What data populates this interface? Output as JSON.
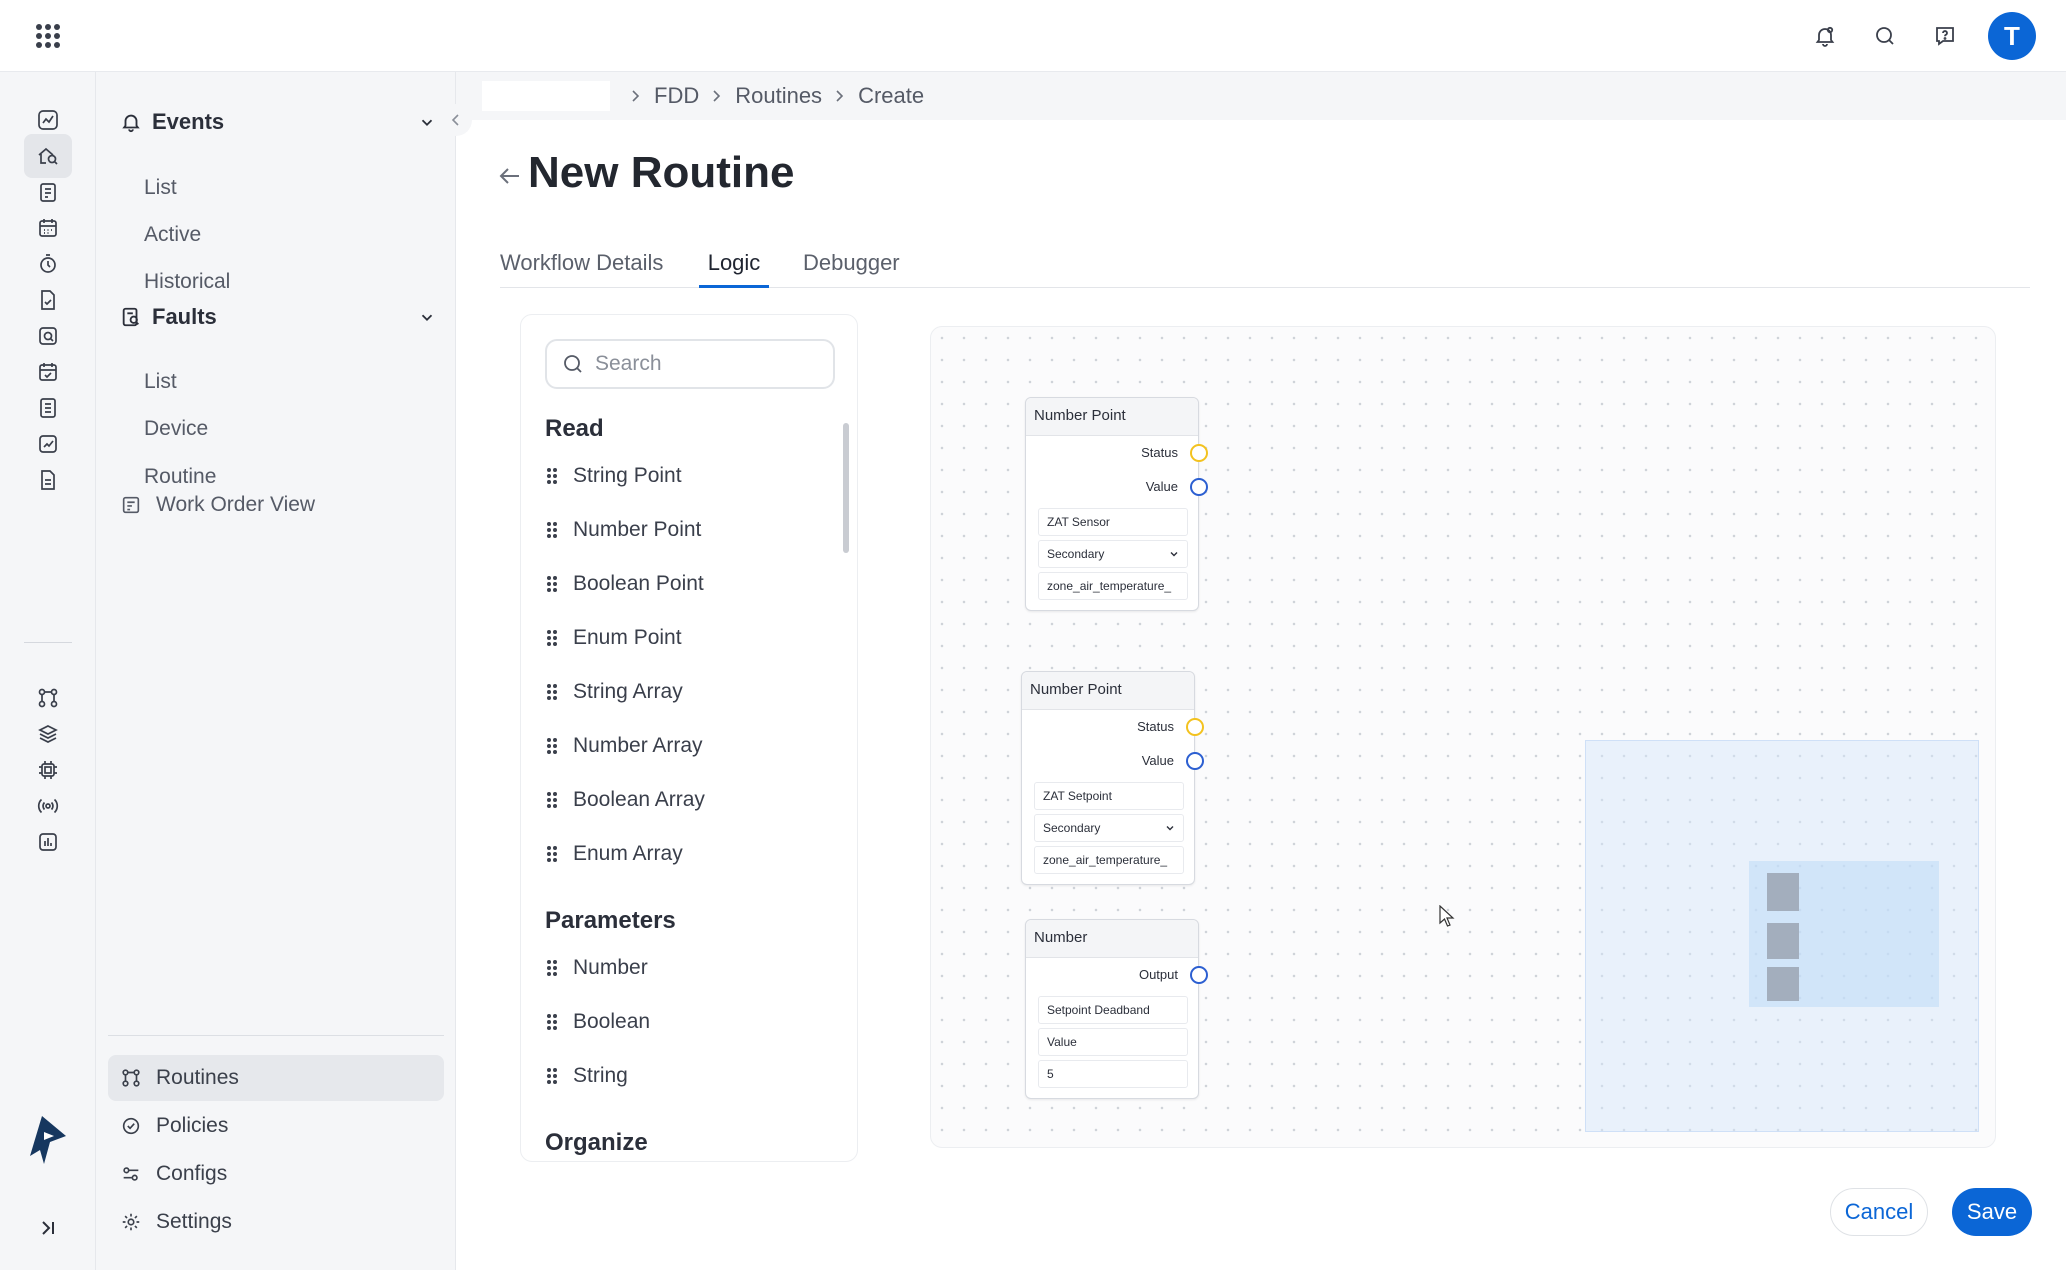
{
  "topbar": {
    "avatar_initial": "T",
    "icons": [
      "apps-grid-icon",
      "bell-icon",
      "search-icon",
      "help-icon"
    ]
  },
  "rail": {
    "icons": [
      "analytics-icon",
      "fdd-icon",
      "clipboard-icon",
      "calendar-icon",
      "timer-icon",
      "file-check-icon",
      "scan-icon",
      "calendar-check-icon",
      "list-icon",
      "chart-icon",
      "document-icon",
      "routines-icon",
      "layers-icon",
      "chip-icon",
      "broadcast-icon",
      "bar-chart-icon"
    ],
    "active_index": 1
  },
  "sidenav": {
    "events": {
      "title": "Events",
      "items": [
        "List",
        "Active",
        "Historical"
      ]
    },
    "faults": {
      "title": "Faults",
      "items": [
        "List",
        "Device",
        "Routine"
      ]
    },
    "work_order_view": "Work Order View",
    "bottom": [
      {
        "label": "Routines",
        "icon": "routines-icon",
        "active": true
      },
      {
        "label": "Policies",
        "icon": "policy-check-icon",
        "active": false
      },
      {
        "label": "Configs",
        "icon": "sliders-icon",
        "active": false
      },
      {
        "label": "Settings",
        "icon": "gear-icon",
        "active": false
      }
    ]
  },
  "breadcrumb": [
    "FDD",
    "Routines",
    "Create"
  ],
  "page": {
    "title": "New Routine",
    "tabs": [
      "Workflow Details",
      "Logic",
      "Debugger"
    ],
    "active_tab": "Logic"
  },
  "palette": {
    "search_placeholder": "Search",
    "read": {
      "title": "Read",
      "items": [
        "String Point",
        "Number Point",
        "Boolean Point",
        "Enum Point",
        "String Array",
        "Number Array",
        "Boolean Array",
        "Enum Array"
      ]
    },
    "parameters": {
      "title": "Parameters",
      "items": [
        "Number",
        "Boolean",
        "String"
      ]
    },
    "organize": {
      "title": "Organize"
    }
  },
  "canvas": {
    "nodes": [
      {
        "title": "Number Point",
        "ports": [
          "Status",
          "Value"
        ],
        "fields": [
          "ZAT Sensor",
          "Secondary",
          "zone_air_temperature_"
        ]
      },
      {
        "title": "Number Point",
        "ports": [
          "Status",
          "Value"
        ],
        "fields": [
          "ZAT Setpoint",
          "Secondary",
          "zone_air_temperature_"
        ]
      },
      {
        "title": "Number",
        "ports": [
          "Output"
        ],
        "fields": [
          "Setpoint Deadband",
          "Value",
          "5"
        ]
      }
    ]
  },
  "actions": {
    "cancel": "Cancel",
    "save": "Save"
  },
  "colors": {
    "accent": "#0b66d6",
    "status_port": "#f3c21f",
    "value_port": "#2c5fd1"
  }
}
